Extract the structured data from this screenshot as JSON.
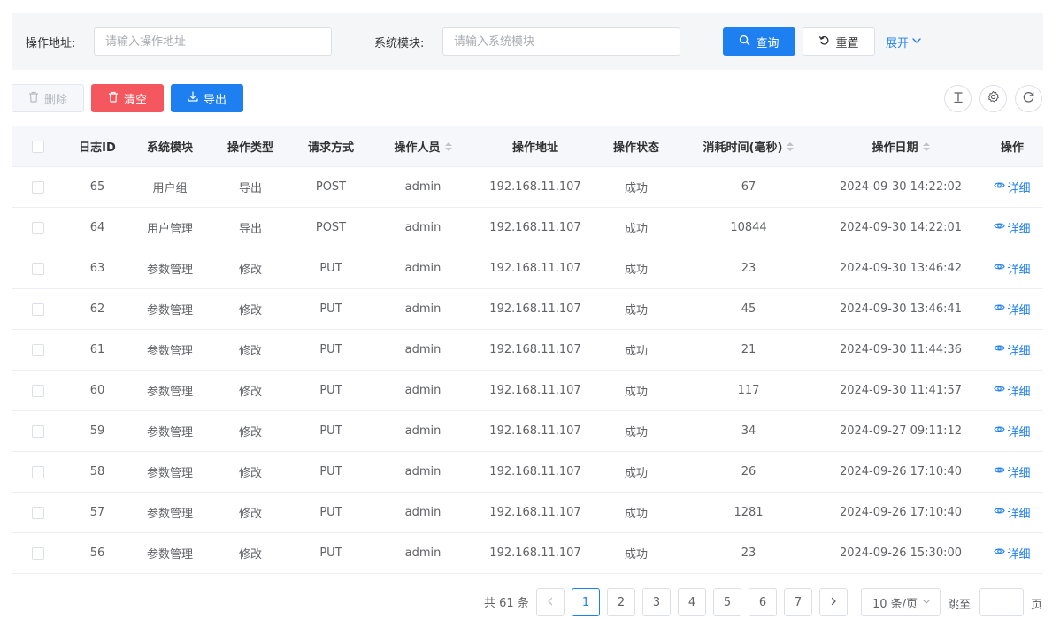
{
  "search": {
    "address_label": "操作地址:",
    "address_placeholder": "请输入操作地址",
    "module_label": "系统模块:",
    "module_placeholder": "请输入系统模块",
    "query_label": "查询",
    "reset_label": "重置",
    "expand_label": "展开"
  },
  "toolbar": {
    "delete_label": "删除",
    "clear_label": "清空",
    "export_label": "导出"
  },
  "table": {
    "headers": [
      "日志ID",
      "系统模块",
      "操作类型",
      "请求方式",
      "操作人员",
      "操作地址",
      "操作状态",
      "消耗时间(毫秒)",
      "操作日期",
      "操作"
    ],
    "detail_label": "详细",
    "rows": [
      [
        "65",
        "用户组",
        "导出",
        "POST",
        "admin",
        "192.168.11.107",
        "成功",
        "67",
        "2024-09-30 14:22:02"
      ],
      [
        "64",
        "用户管理",
        "导出",
        "POST",
        "admin",
        "192.168.11.107",
        "成功",
        "10844",
        "2024-09-30 14:22:01"
      ],
      [
        "63",
        "参数管理",
        "修改",
        "PUT",
        "admin",
        "192.168.11.107",
        "成功",
        "23",
        "2024-09-30 13:46:42"
      ],
      [
        "62",
        "参数管理",
        "修改",
        "PUT",
        "admin",
        "192.168.11.107",
        "成功",
        "45",
        "2024-09-30 13:46:41"
      ],
      [
        "61",
        "参数管理",
        "修改",
        "PUT",
        "admin",
        "192.168.11.107",
        "成功",
        "21",
        "2024-09-30 11:44:36"
      ],
      [
        "60",
        "参数管理",
        "修改",
        "PUT",
        "admin",
        "192.168.11.107",
        "成功",
        "117",
        "2024-09-30 11:41:57"
      ],
      [
        "59",
        "参数管理",
        "修改",
        "PUT",
        "admin",
        "192.168.11.107",
        "成功",
        "34",
        "2024-09-27 09:11:12"
      ],
      [
        "58",
        "参数管理",
        "修改",
        "PUT",
        "admin",
        "192.168.11.107",
        "成功",
        "26",
        "2024-09-26 17:10:40"
      ],
      [
        "57",
        "参数管理",
        "修改",
        "PUT",
        "admin",
        "192.168.11.107",
        "成功",
        "1281",
        "2024-09-26 17:10:40"
      ],
      [
        "56",
        "参数管理",
        "修改",
        "PUT",
        "admin",
        "192.168.11.107",
        "成功",
        "23",
        "2024-09-26 15:30:00"
      ]
    ]
  },
  "pagination": {
    "total_label": "共 61 条",
    "pages": [
      "1",
      "2",
      "3",
      "4",
      "5",
      "6",
      "7"
    ],
    "current_page": "1",
    "page_size_label": "10 条/页",
    "jump_prefix": "跳至",
    "jump_suffix": "页"
  },
  "colors": {
    "primary": "#1e7ff0",
    "danger": "#f4585e"
  },
  "icons": [
    "search-icon",
    "refresh-ccw-icon",
    "chevron-down-icon",
    "trash-icon",
    "download-icon",
    "text-height-icon",
    "settings-icon",
    "refresh-icon",
    "eye-icon",
    "sort-icon"
  ]
}
